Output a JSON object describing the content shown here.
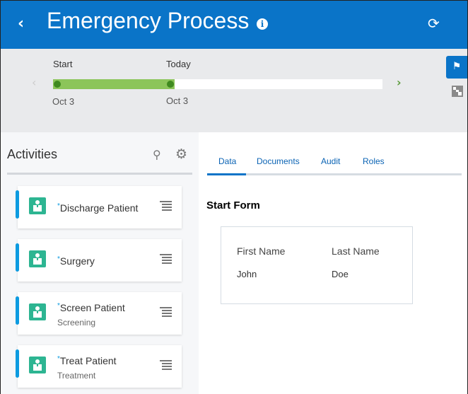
{
  "header": {
    "title": "Emergency Process",
    "back_icon": "chevron-left-icon",
    "info_icon": "info-icon",
    "info_glyph": "i",
    "refresh_icon": "refresh-icon"
  },
  "timeline": {
    "start_label": "Start",
    "start_date": "Oct 3",
    "today_label": "Today",
    "today_date": "Oct 3",
    "progress_fraction": 0.37,
    "colors": {
      "fill": "#8cc55a",
      "dot": "#3f8a1f"
    }
  },
  "side_tools": [
    {
      "name": "milestone-view",
      "icon": "signpost-icon",
      "active": true
    },
    {
      "name": "tree-view",
      "icon": "hierarchy-icon",
      "active": false
    }
  ],
  "activities": {
    "title": "Activities",
    "search_icon": "search-icon",
    "settings_icon": "gear-icon",
    "items": [
      {
        "marker": "*",
        "name": "Discharge Patient",
        "subtitle": ""
      },
      {
        "marker": "*",
        "name": "Surgery",
        "subtitle": ""
      },
      {
        "marker": "*",
        "name": "Screen Patient",
        "subtitle": "Screening"
      },
      {
        "marker": "*",
        "name": "Treat Patient",
        "subtitle": "Treatment"
      }
    ]
  },
  "tabs": [
    {
      "label": "Data",
      "active": true
    },
    {
      "label": "Documents",
      "active": false
    },
    {
      "label": "Audit",
      "active": false
    },
    {
      "label": "Roles",
      "active": false
    }
  ],
  "form": {
    "title": "Start Form",
    "fields": [
      {
        "label": "First Name",
        "value": "John"
      },
      {
        "label": "Last Name",
        "value": "Doe"
      }
    ]
  },
  "colors": {
    "brand": "#0a74c8",
    "accent_bar": "#0d9be0",
    "activity_icon": "#2db592"
  }
}
